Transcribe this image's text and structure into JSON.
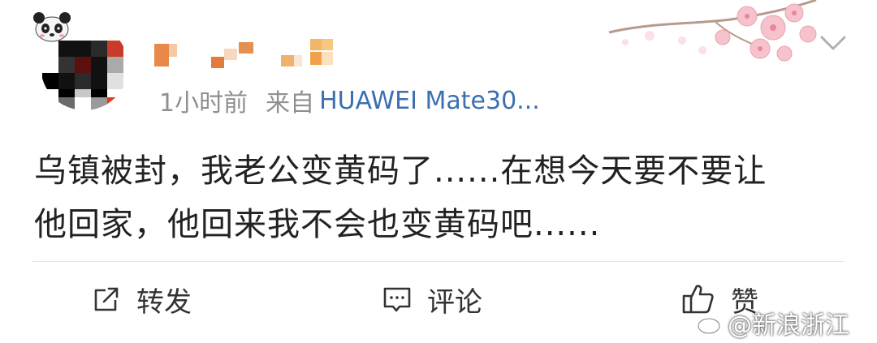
{
  "post": {
    "time": "1小时前",
    "from_label": "来自",
    "device": "HUAWEI Mate30...",
    "content_line1": "乌镇被封，我老公变黄码了......在想今天要不要让",
    "content_line2": "他回家，他回来我不会也变黄码吧......"
  },
  "actions": {
    "repost": "转发",
    "comment": "评论",
    "like": "赞"
  },
  "watermark": {
    "text": "@新浪浙江"
  },
  "icons": {
    "avatar": "avatar-mosaic",
    "panda": "panda-icon",
    "blossom": "cherry-blossom-icon",
    "more": "chevron-down-icon",
    "repost": "repost-icon",
    "comment": "comment-icon",
    "like": "thumbs-up-icon",
    "weibo": "weibo-logo-icon"
  },
  "colors": {
    "text": "#222222",
    "meta": "#8f8f8f",
    "device_link": "#3b6fb0",
    "divider": "#e6e6e6"
  }
}
